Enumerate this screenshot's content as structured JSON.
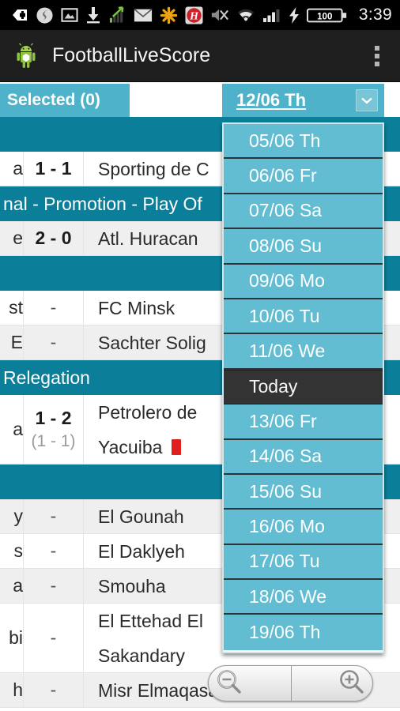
{
  "status_bar": {
    "icons": [
      {
        "name": "shield-plus-icon"
      },
      {
        "name": "swirl-app-icon"
      },
      {
        "name": "photo-icon"
      },
      {
        "name": "download-icon"
      },
      {
        "name": "signal-graph-icon"
      },
      {
        "name": "mail-icon"
      },
      {
        "name": "asterisk-icon"
      },
      {
        "name": "h-badge-icon"
      },
      {
        "name": "mute-icon"
      },
      {
        "name": "wifi-icon"
      },
      {
        "name": "cell-signal-icon"
      },
      {
        "name": "charging-bolt-icon"
      }
    ],
    "battery_level": "100",
    "clock": "3:39"
  },
  "action_bar": {
    "title": "FootballLiveScore",
    "app_icon": "android-robot-icon",
    "overflow_icon": "overflow-menu-icon"
  },
  "toolbar": {
    "selected_label": "Selected (0)",
    "date_spinner_value": "12/06 Th",
    "caret_icon": "chevron-down-icon"
  },
  "date_dropdown": {
    "open": true,
    "items": [
      {
        "label": "05/06 Th",
        "today": false
      },
      {
        "label": "06/06 Fr",
        "today": false
      },
      {
        "label": "07/06 Sa",
        "today": false
      },
      {
        "label": "08/06 Su",
        "today": false
      },
      {
        "label": "09/06 Mo",
        "today": false
      },
      {
        "label": "10/06 Tu",
        "today": false
      },
      {
        "label": "11/06 We",
        "today": false
      },
      {
        "label": "Today",
        "today": true
      },
      {
        "label": "13/06 Fr",
        "today": false
      },
      {
        "label": "14/06 Sa",
        "today": false
      },
      {
        "label": "15/06 Su",
        "today": false
      },
      {
        "label": "16/06 Mo",
        "today": false
      },
      {
        "label": "17/06 Tu",
        "today": false
      },
      {
        "label": "18/06 We",
        "today": false
      },
      {
        "label": "19/06 Th",
        "today": false
      }
    ]
  },
  "match_list": {
    "rows": [
      {
        "type": "league",
        "label": ""
      },
      {
        "type": "match",
        "home": "a",
        "score": "1 - 1",
        "bold": true,
        "agg": "",
        "away": "Sporting de C",
        "away2": "",
        "red_card": false,
        "alt": false
      },
      {
        "type": "league",
        "label": "nal - Promotion - Play Of"
      },
      {
        "type": "match",
        "home": "e",
        "score": "2 - 0",
        "bold": true,
        "agg": "",
        "away": "Atl. Huracan",
        "away2": "",
        "red_card": false,
        "alt": true
      },
      {
        "type": "league",
        "label": ""
      },
      {
        "type": "match",
        "home": "st",
        "score": "-",
        "bold": false,
        "agg": "",
        "away": "FC Minsk",
        "away2": "",
        "red_card": false,
        "alt": false
      },
      {
        "type": "match",
        "home": "E",
        "score": "-",
        "bold": false,
        "agg": "",
        "away": "Sachter Solig",
        "away2": "",
        "red_card": false,
        "alt": true
      },
      {
        "type": "league",
        "label": "Relegation"
      },
      {
        "type": "match",
        "home": "a",
        "score": "1 - 2",
        "bold": true,
        "agg": "(1 - 1)",
        "away": "Petrolero de",
        "away2": "Yacuiba",
        "red_card": true,
        "alt": false
      },
      {
        "type": "league",
        "label": ""
      },
      {
        "type": "match",
        "home": "y",
        "score": "-",
        "bold": false,
        "agg": "",
        "away": "El Gounah",
        "away2": "",
        "red_card": false,
        "alt": true
      },
      {
        "type": "match",
        "home": "s",
        "score": "-",
        "bold": false,
        "agg": "",
        "away": "El Daklyeh",
        "away2": "",
        "red_card": false,
        "alt": false
      },
      {
        "type": "match",
        "home": "a",
        "score": "-",
        "bold": false,
        "agg": "",
        "away": "Smouha",
        "away2": "",
        "red_card": false,
        "alt": true
      },
      {
        "type": "match",
        "home": "bi",
        "score": "-",
        "bold": false,
        "agg": "",
        "away": "El Ettehad El",
        "away2": "Sakandary",
        "red_card": false,
        "alt": false
      },
      {
        "type": "match",
        "home": "h",
        "score": "-",
        "bold": false,
        "agg": "",
        "away": "Misr Elmaqasah",
        "away2": "",
        "red_card": false,
        "alt": true
      }
    ]
  },
  "zoom_controls": {
    "zoom_out_icon": "zoom-out-icon",
    "zoom_in_icon": "zoom-in-icon"
  },
  "colors": {
    "accent_light": "#4eb3ca",
    "accent_dark": "#0b7e99",
    "dropdown_item": "#62bdd2",
    "today_bg": "#333333",
    "red_card": "#e02020"
  }
}
